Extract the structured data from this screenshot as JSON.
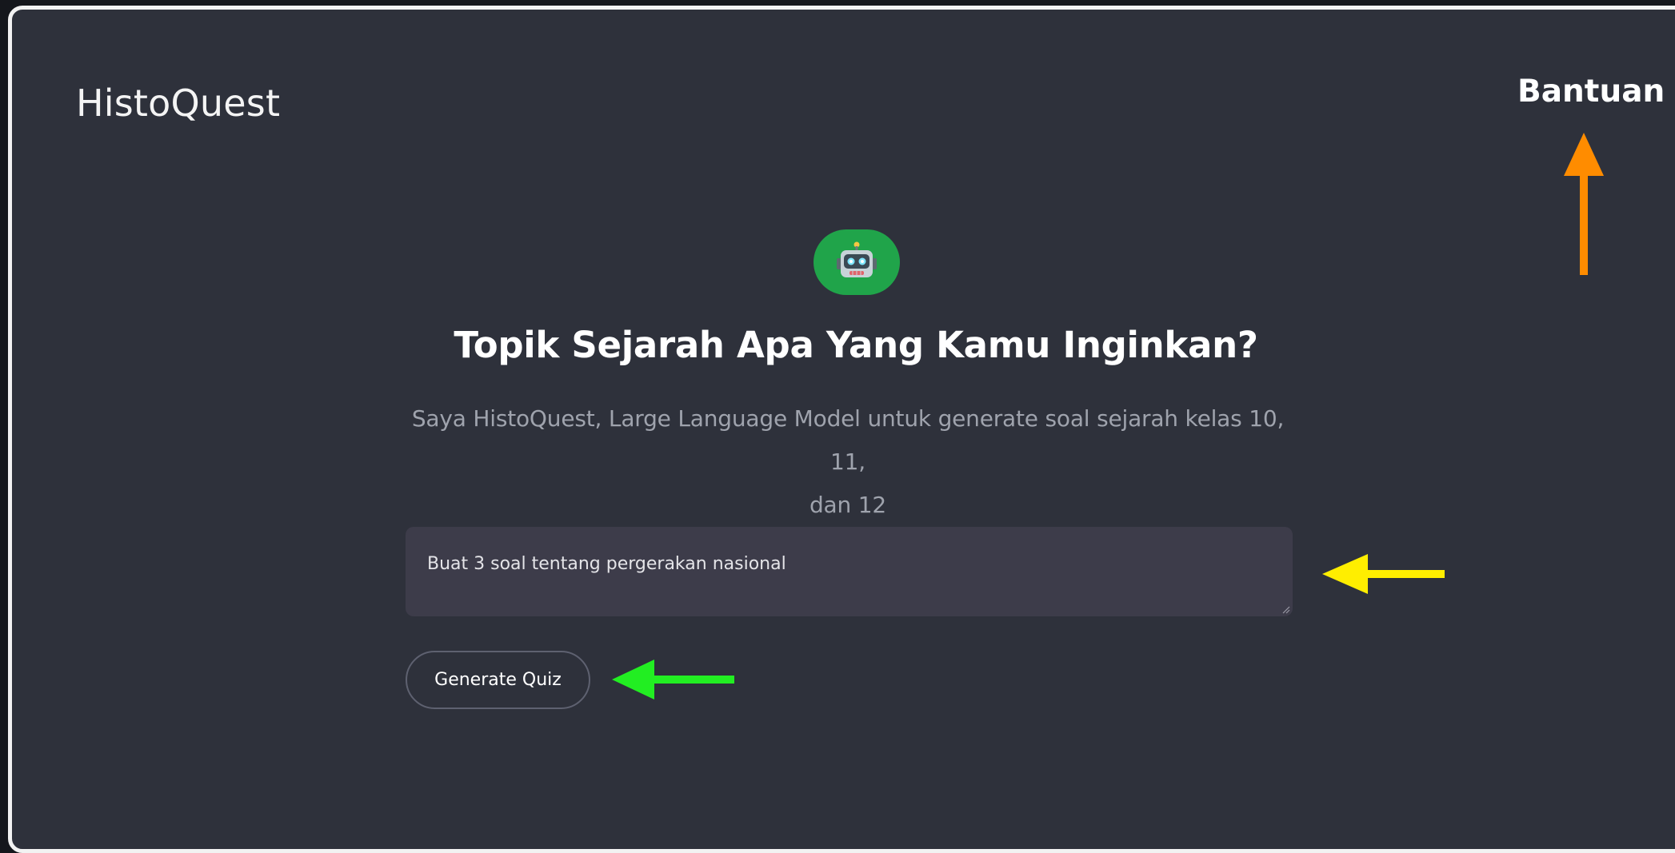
{
  "header": {
    "app_title": "HistoQuest",
    "help_link": "Bantuan"
  },
  "main": {
    "avatar_icon": "robot-icon",
    "heading": "Topik Sejarah Apa Yang Kamu Inginkan?",
    "subtitle_line1": "Saya HistoQuest, Large Language Model untuk generate soal sejarah kelas 10, 11,",
    "subtitle_line2": "dan 12",
    "prompt_value": "Buat 3 soal tentang pergerakan nasional",
    "generate_button": "Generate Quiz"
  },
  "colors": {
    "background": "#2e313b",
    "avatar_bg": "#20a44a",
    "input_bg": "#3d3c4a",
    "annotation_orange": "#ff8c00",
    "annotation_yellow": "#ffee00",
    "annotation_green": "#22ee22"
  }
}
